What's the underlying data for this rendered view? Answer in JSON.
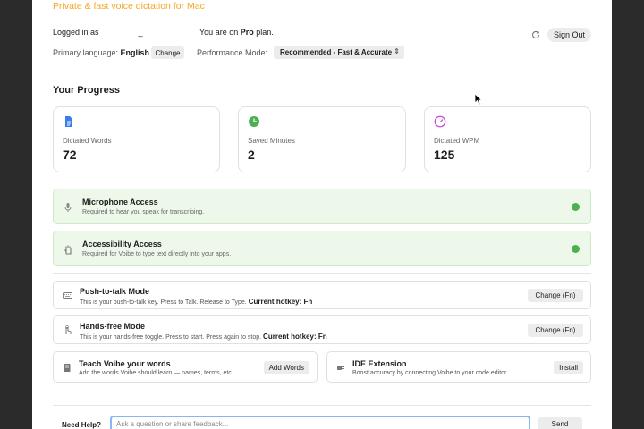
{
  "header": {
    "tagline": "Private & fast voice dictation for Mac"
  },
  "account": {
    "logged_in_label": "Logged in as",
    "logged_in_value": "_",
    "plan_prefix": "You are on ",
    "plan_name": "Pro",
    "plan_suffix": " plan.",
    "sign_out_label": "Sign Out",
    "refresh_icon": "refresh-icon"
  },
  "settings": {
    "language_label": "Primary language: ",
    "language_value": "English",
    "change_language_label": "Change",
    "performance_label": "Performance Mode:",
    "performance_value": "Recommended - Fast & Accurate"
  },
  "progress": {
    "title": "Your Progress",
    "cards": [
      {
        "icon": "document-icon",
        "label": "Dictated Words",
        "value": "72",
        "color": "#3b7de9"
      },
      {
        "icon": "clock-icon",
        "label": "Saved Minutes",
        "value": "2",
        "color": "#4caf50"
      },
      {
        "icon": "speedometer-icon",
        "label": "Dictated WPM",
        "value": "125",
        "color": "#c341e0"
      }
    ]
  },
  "permissions": [
    {
      "icon": "microphone-icon",
      "title": "Microphone Access",
      "desc": "Required to hear you speak for transcribing.",
      "status_icon": "check-icon"
    },
    {
      "icon": "hand-icon",
      "title": "Accessibility Access",
      "desc": "Required for Voibe to type text directly into your apps.",
      "status_icon": "check-icon"
    }
  ],
  "modes": [
    {
      "icon": "keyboard-icon",
      "title": "Push-to-talk Mode",
      "desc": "This is your push-to-talk key. Press to Talk. Release to Type. ",
      "hotkey_label": "Current hotkey: Fn",
      "button": "Change (Fn)"
    },
    {
      "icon": "tap-icon",
      "title": "Hands-free Mode",
      "desc": "This is your hands-free toggle. Press to start. Press again to stop. ",
      "hotkey_label": "Current hotkey: Fn",
      "button": "Change (Fn)"
    }
  ],
  "extras": [
    {
      "icon": "book-icon",
      "title": "Teach Voibe your words",
      "desc": "Add the words Voibe should learn — names, terms, etc.",
      "button": "Add Words"
    },
    {
      "icon": "plug-icon",
      "title": "IDE Extension",
      "desc": "Boost accuracy by connecting Voibe to your code editor.",
      "button": "Install"
    }
  ],
  "help": {
    "label": "Need Help?",
    "placeholder": "Ask a question or share feedback...",
    "send_label": "Send"
  }
}
